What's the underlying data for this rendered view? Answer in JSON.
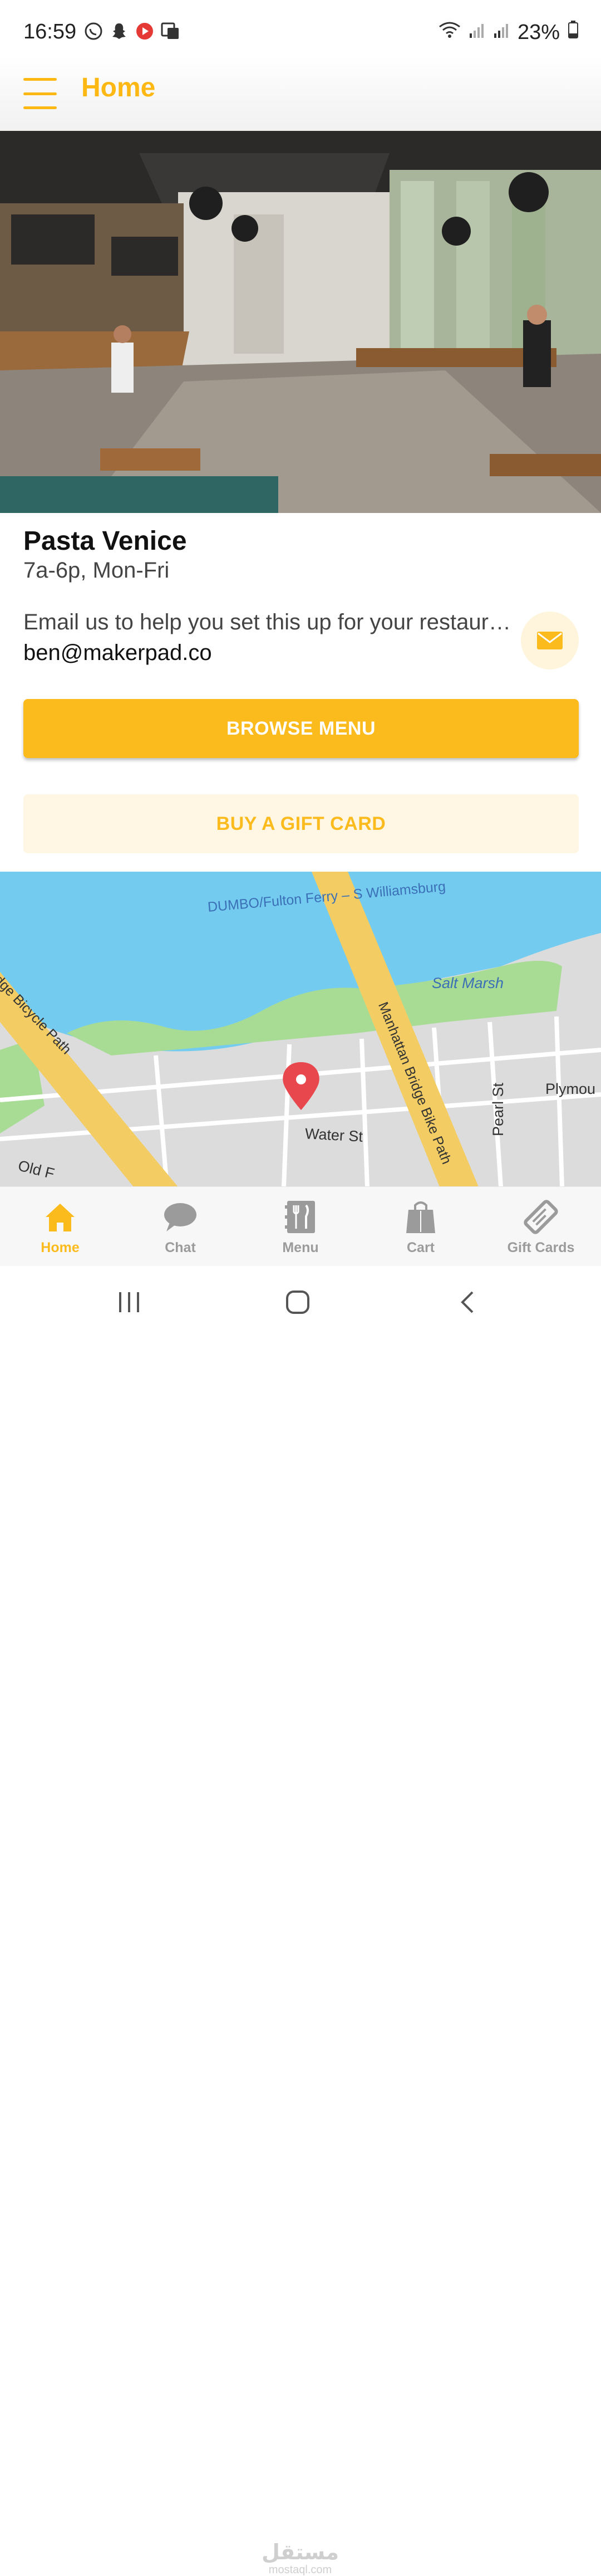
{
  "status_bar": {
    "time": "16:59",
    "battery": "23%",
    "left_icons": [
      "whatsapp-icon",
      "snapchat-icon",
      "youtube-icon",
      "translate-icon"
    ],
    "right_icons": [
      "wifi-icon",
      "signal-icon",
      "signal-icon",
      "battery-icon"
    ]
  },
  "app_bar": {
    "title": "Home",
    "menu_icon": "menu-icon"
  },
  "restaurant": {
    "name": "Pasta Venice",
    "hours": "7a-6p, Mon-Fri",
    "email_prompt": "Email us to help you set this up for your restaurant",
    "email": "ben@makerpad.co"
  },
  "buttons": {
    "browse_menu": "BROWSE MENU",
    "gift_card": "BUY A GIFT CARD"
  },
  "map": {
    "labels": {
      "ferry": "DUMBO/Fulton Ferry – S Williamsburg",
      "salt_marsh": "Salt Marsh",
      "bike_path": "Manhattan Bridge Bike Path",
      "bridge_path": "dge Bicycle Path",
      "pearl_st": "Pearl St",
      "plymouth": "Plymou",
      "water_st": "Water St",
      "old_f": "Old F"
    }
  },
  "bottom_nav": {
    "items": [
      {
        "label": "Home",
        "icon": "home-icon",
        "active": true
      },
      {
        "label": "Chat",
        "icon": "chat-icon",
        "active": false
      },
      {
        "label": "Menu",
        "icon": "menu-book-icon",
        "active": false
      },
      {
        "label": "Cart",
        "icon": "shopping-bag-icon",
        "active": false
      },
      {
        "label": "Gift Cards",
        "icon": "gift-card-icon",
        "active": false
      }
    ]
  },
  "watermark": {
    "arabic": "مستقل",
    "latin": "mostaql.com"
  },
  "colors": {
    "accent": "#FCBB1C",
    "accent_light": "#FFF6E3",
    "inactive": "#9b9b9b",
    "water": "#73CCF0",
    "park": "#A8DC95",
    "road": "#F3CD63",
    "pin": "#E8474E"
  }
}
